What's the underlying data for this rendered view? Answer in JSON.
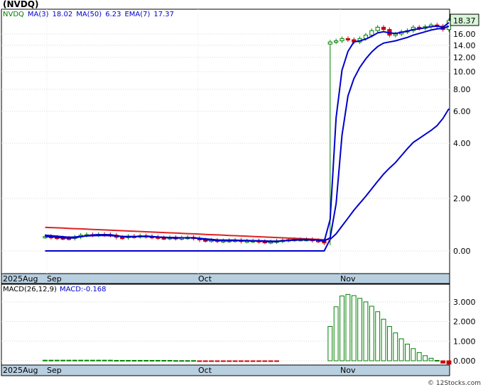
{
  "header": {
    "title": "(NVDQ)",
    "legend": [
      {
        "label": "NVDQ",
        "color": "#008000"
      },
      {
        "label": "MA(3)",
        "color": "#0000cc"
      },
      {
        "label": "18.02",
        "color": "#0000cc"
      },
      {
        "label": "MA(50)",
        "color": "#0000cc"
      },
      {
        "label": "6.23",
        "color": "#0000cc"
      },
      {
        "label": "EMA(7)",
        "color": "#0000cc"
      },
      {
        "label": "17.37",
        "color": "#0000cc"
      }
    ],
    "last_price": "18.37"
  },
  "macd_legend": [
    {
      "label": "MACD(26,12,9)",
      "color": "#000000"
    },
    {
      "label": "MACD:-0.168",
      "color": "#0000cc"
    }
  ],
  "credit": "© 12Stocks.com",
  "colors": {
    "up": "#008000",
    "down": "#cc0000",
    "ma": "#0000cc",
    "ema": "#dd2222",
    "axisband": "#b8cfe0"
  },
  "chart_data": [
    {
      "type": "candlestick",
      "symbol": "NVDQ",
      "scale": "log",
      "y_ticks": [
        "16.00",
        "14.00",
        "12.00",
        "10.00",
        "8.00",
        "6.00",
        "4.00",
        "2.00",
        "0.00"
      ],
      "x_labels": [
        "2025Aug",
        "Sep",
        "Oct",
        "Nov"
      ],
      "close": [
        0.55,
        0.52,
        0.5,
        0.49,
        0.48,
        0.53,
        0.6,
        0.62,
        0.61,
        0.63,
        0.62,
        0.6,
        0.52,
        0.51,
        0.56,
        0.55,
        0.58,
        0.55,
        0.53,
        0.5,
        0.49,
        0.51,
        0.48,
        0.5,
        0.52,
        0.48,
        0.42,
        0.4,
        0.41,
        0.38,
        0.39,
        0.4,
        0.41,
        0.37,
        0.38,
        0.39,
        0.36,
        0.34,
        0.35,
        0.38,
        0.41,
        0.43,
        0.44,
        0.44,
        0.44,
        0.4,
        0.38,
        0.3,
        14.6,
        14.8,
        15.2,
        15.0,
        14.6,
        15.2,
        15.8,
        16.6,
        17.2,
        16.8,
        15.8,
        16.0,
        16.4,
        16.6,
        17.2,
        17.0,
        17.3,
        17.6,
        17.4,
        16.8,
        18.37
      ],
      "ma3": [
        0.55,
        0.54,
        0.52,
        0.5,
        0.49,
        0.5,
        0.54,
        0.58,
        0.61,
        0.62,
        0.62,
        0.62,
        0.58,
        0.54,
        0.53,
        0.54,
        0.56,
        0.56,
        0.55,
        0.53,
        0.51,
        0.5,
        0.49,
        0.5,
        0.5,
        0.5,
        0.47,
        0.43,
        0.41,
        0.4,
        0.39,
        0.39,
        0.4,
        0.39,
        0.38,
        0.38,
        0.38,
        0.36,
        0.35,
        0.36,
        0.38,
        0.41,
        0.43,
        0.44,
        0.44,
        0.43,
        0.41,
        0.36,
        1.2,
        5.6,
        10.2,
        13.0,
        14.6,
        14.8,
        15.1,
        15.6,
        16.2,
        16.4,
        16.2,
        16.1,
        16.3,
        16.5,
        16.8,
        16.9,
        17.1,
        17.3,
        17.4,
        17.2,
        18.02
      ],
      "ema7": [
        0.6,
        0.58,
        0.56,
        0.54,
        0.52,
        0.53,
        0.55,
        0.57,
        0.58,
        0.59,
        0.59,
        0.58,
        0.57,
        0.55,
        0.55,
        0.55,
        0.55,
        0.55,
        0.54,
        0.53,
        0.52,
        0.51,
        0.51,
        0.5,
        0.5,
        0.5,
        0.48,
        0.46,
        0.44,
        0.42,
        0.41,
        0.41,
        0.41,
        0.4,
        0.4,
        0.39,
        0.39,
        0.38,
        0.37,
        0.37,
        0.38,
        0.4,
        0.41,
        0.42,
        0.42,
        0.42,
        0.41,
        0.38,
        0.5,
        1.8,
        4.5,
        7.4,
        9.2,
        10.6,
        11.8,
        12.9,
        13.8,
        14.4,
        14.6,
        14.8,
        15.1,
        15.4,
        15.8,
        16.1,
        16.4,
        16.7,
        16.9,
        17.0,
        17.37
      ],
      "ma50": [
        0.9,
        0.89,
        0.88,
        0.87,
        0.86,
        0.85,
        0.84,
        0.83,
        0.82,
        0.81,
        0.8,
        0.79,
        0.78,
        0.77,
        0.76,
        0.75,
        0.74,
        0.73,
        0.72,
        0.71,
        0.7,
        0.69,
        0.68,
        0.67,
        0.66,
        0.65,
        0.64,
        0.63,
        0.62,
        0.61,
        0.6,
        0.59,
        0.58,
        0.57,
        0.56,
        0.55,
        0.54,
        0.53,
        0.52,
        0.51,
        0.5,
        0.49,
        0.48,
        0.47,
        0.46,
        0.45,
        0.44,
        0.43,
        0.44,
        0.65,
        0.95,
        1.25,
        1.55,
        1.82,
        2.08,
        2.35,
        2.62,
        2.88,
        3.1,
        3.3,
        3.55,
        3.8,
        4.05,
        4.3,
        4.55,
        4.8,
        5.1,
        5.55,
        6.23
      ]
    },
    {
      "type": "bar",
      "name": "MACD(26,12,9)",
      "y_ticks": [
        "3.000",
        "2.000",
        "1.000",
        "0.000"
      ],
      "values": [
        0.03,
        0.03,
        0.03,
        0.03,
        0.03,
        0.03,
        0.03,
        0.03,
        0.03,
        0.03,
        0.03,
        0.03,
        0.02,
        0.02,
        0.02,
        0.02,
        0.02,
        0.02,
        0.02,
        0.02,
        0.02,
        0.02,
        0.01,
        0.01,
        0.01,
        0.01,
        -0.01,
        -0.01,
        -0.01,
        -0.01,
        -0.01,
        -0.01,
        -0.01,
        -0.01,
        -0.01,
        -0.01,
        -0.01,
        -0.01,
        -0.01,
        -0.01,
        0.0,
        0.0,
        0.0,
        0.0,
        0.0,
        0.0,
        0.0,
        0.0,
        1.75,
        2.75,
        3.3,
        3.38,
        3.32,
        3.18,
        3.0,
        2.78,
        2.5,
        2.12,
        1.75,
        1.42,
        1.12,
        0.85,
        0.62,
        0.42,
        0.26,
        0.13,
        0.02,
        -0.12,
        -0.168
      ]
    }
  ]
}
